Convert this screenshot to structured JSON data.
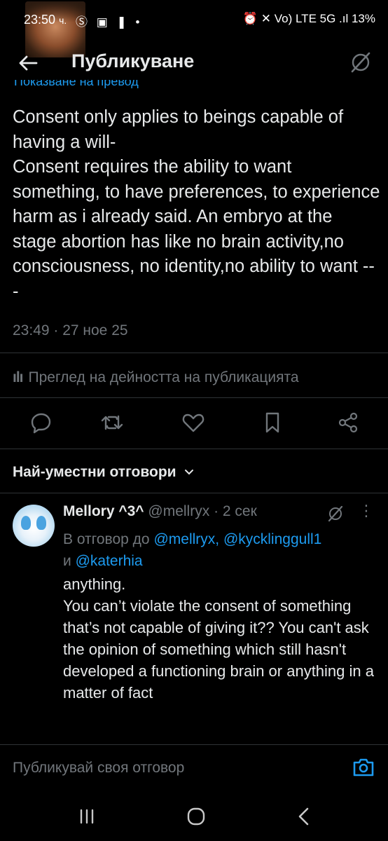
{
  "status_bar": {
    "time": "23:50",
    "time_suffix": "ч.",
    "left_icons": "Ⓢ ▣ ❚ •",
    "right_text": "⏰ ✕ Vo) LTE 5G .ıl 13%",
    "battery": "13%"
  },
  "header": {
    "title": "Публикуване",
    "translate_text": "Показване на превод"
  },
  "post": {
    "text": "Consent only applies to beings capable of having a will-\nConsent requires the ability to want something, to have preferences, to experience harm as i already said. An embryo at the stage abortion has like no brain activity,no consciousness, no identity,no ability to want ---",
    "time": "23:49 · 27 ное 25",
    "analytics_label": "Преглед на дейността на публикацията"
  },
  "actions": [
    "reply",
    "repost",
    "like",
    "bookmark",
    "share"
  ],
  "replies_section": {
    "title": "Най-уместни отговори",
    "chevron": "⌄"
  },
  "reply": {
    "display_name": "Mellory ^3^",
    "handle": "@mellryx",
    "age": "· 2 сек",
    "more": "⋮",
    "replying_prefix": "В отговор до",
    "mentions": [
      "@mellryx,",
      "@kycklinggull1",
      "@katerhia"
    ],
    "mention_joiner": "и",
    "text": "anything.\nYou can’t violate the consent of something that’s not capable of giving it?? You can't ask the opinion of something which still hasn't developed a functioning brain or anything in a matter of fact"
  },
  "compose": {
    "placeholder": "Публикувай своя отговор"
  },
  "colors": {
    "background": "#000000",
    "text": "#e7e9ea",
    "muted": "#71767b",
    "accent": "#1d9bf0",
    "divider": "#2f3336"
  }
}
